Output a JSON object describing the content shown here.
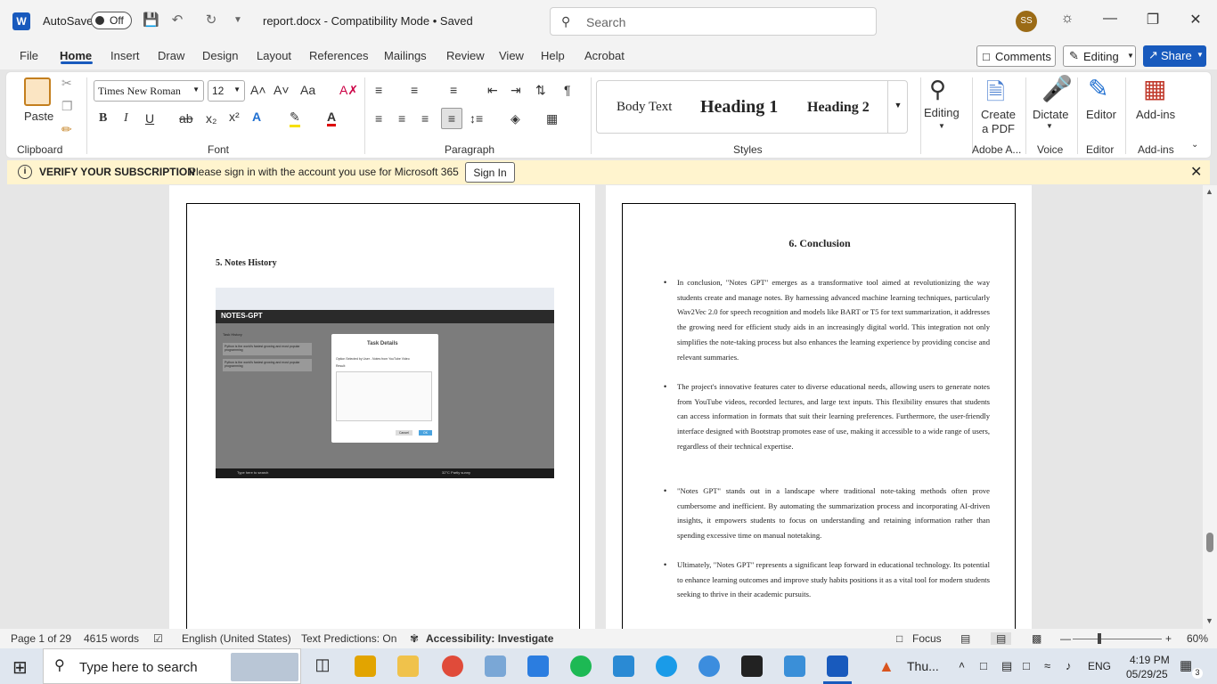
{
  "titlebar": {
    "autosave_label": "AutoSave",
    "autosave_state": "Off",
    "doc_title": "report.docx  -  Compatibility Mode • Saved",
    "search_placeholder": "Search",
    "avatar_initials": "SS"
  },
  "tabs": [
    "File",
    "Home",
    "Insert",
    "Draw",
    "Design",
    "Layout",
    "References",
    "Mailings",
    "Review",
    "View",
    "Help",
    "Acrobat"
  ],
  "active_tab": "Home",
  "top_actions": {
    "comments": "Comments",
    "editing": "Editing",
    "share": "Share"
  },
  "ribbon": {
    "clipboard": {
      "label": "Clipboard",
      "paste": "Paste"
    },
    "font": {
      "label": "Font",
      "family": "Times New Roman",
      "size": "12",
      "bold": "B",
      "italic": "I",
      "underline": "U",
      "strike": "ab",
      "sub": "x₂",
      "sup": "x²"
    },
    "paragraph": {
      "label": "Paragraph"
    },
    "styles": {
      "label": "Styles",
      "items": [
        "Body Text",
        "Heading 1",
        "Heading 2"
      ]
    },
    "editing": {
      "label": "Editing"
    },
    "adobe": {
      "create_pdf_line1": "Create",
      "create_pdf_line2": "a PDF",
      "group_label": "Adobe A..."
    },
    "voice": {
      "dictate": "Dictate",
      "label": "Voice"
    },
    "editor": {
      "button": "Editor",
      "label": "Editor"
    },
    "addins": {
      "button": "Add-ins",
      "label": "Add-ins"
    }
  },
  "message_bar": {
    "title": "VERIFY YOUR SUBSCRIPTION",
    "text": "Please sign in with the account you use for Microsoft 365",
    "button": "Sign In"
  },
  "page_left": {
    "heading": "5. Notes History",
    "screenshot": {
      "app_name": "NOTES-GPT",
      "sidebar_title": "Task History",
      "item1": "Python is the world's fastest growing and most popular programming",
      "item2": "Python is the world's fastest growing and most popular programming",
      "dialog_title": "Task Details",
      "dialog_option": "Option Selected by User - Notes from YouTube Video",
      "dialog_result": "Result:",
      "dialog_cancel": "Cancel",
      "dialog_ok": "OK",
      "taskbar_search": "Type here to search",
      "weather": "32°C Partly sunny"
    }
  },
  "page_right": {
    "heading": "6. Conclusion",
    "bullets": [
      "In conclusion, \"Notes GPT\" emerges as a transformative tool aimed at revolutionizing the way students create and manage notes. By harnessing advanced machine learning techniques, particularly Wav2Vec 2.0 for speech recognition and models like BART or T5 for text summarization, it addresses the growing need for efficient study aids in an increasingly digital world. This integration not only simplifies the note-taking process but also enhances the learning experience by providing concise and relevant summaries.",
      "The project's innovative features cater to diverse educational needs, allowing users to generate notes from YouTube videos, recorded lectures, and large text inputs. This flexibility ensures that students can access information in formats that suit their learning preferences. Furthermore, the user-friendly interface designed with Bootstrap promotes ease of use, making it accessible to a wide range of users, regardless of their technical expertise.",
      "\"Notes GPT\" stands out in a landscape where traditional note-taking methods often prove cumbersome and inefficient. By automating the summarization process and incorporating AI-driven insights, it empowers students to focus on understanding and retaining information rather than spending excessive time on manual notetaking.",
      "Ultimately, \"Notes GPT\" represents a significant leap forward in educational technology. Its potential to enhance learning outcomes and improve study habits positions it as a vital tool for modern students seeking to thrive in their academic pursuits."
    ]
  },
  "statusbar": {
    "page": "Page 1 of 29",
    "words": "4615 words",
    "language": "English (United States)",
    "predictions": "Text Predictions: On",
    "accessibility": "Accessibility: Investigate",
    "focus": "Focus",
    "zoom": "60%"
  },
  "taskbar": {
    "search_placeholder": "Type here to search",
    "weather": "Thu...",
    "lang": "ENG",
    "time": "4:19 PM",
    "date": "05/29/25",
    "notif_count": "3"
  }
}
